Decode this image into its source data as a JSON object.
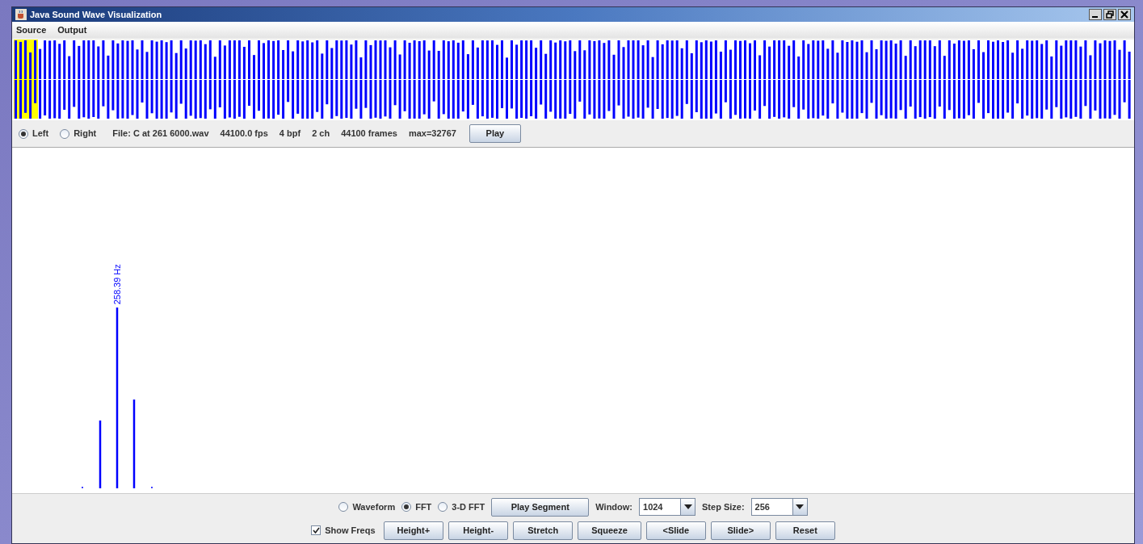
{
  "window": {
    "title": "Java Sound Wave Visualization"
  },
  "menu": [
    "Source",
    "Output"
  ],
  "channels": [
    {
      "label": "Left",
      "selected": true
    },
    {
      "label": "Right",
      "selected": false
    }
  ],
  "file_info": [
    "File: C at 261 6000.wav",
    "44100.0 fps",
    "4 bpf",
    "2 ch",
    "44100 frames",
    "max=32767"
  ],
  "play_button": "Play",
  "spectrum": {
    "peak_label": "258.39 Hz"
  },
  "view_modes": [
    {
      "label": "Waveform",
      "selected": false
    },
    {
      "label": "FFT",
      "selected": true
    },
    {
      "label": "3-D FFT",
      "selected": false
    }
  ],
  "play_segment": "Play Segment",
  "window_size": {
    "label": "Window:",
    "value": "1024"
  },
  "step_size": {
    "label": "Step Size:",
    "value": "256"
  },
  "show_freqs": {
    "label": "Show Freqs",
    "checked": true
  },
  "buttons": [
    "Height+",
    "Height-",
    "Stretch",
    "Squeeze",
    "<Slide",
    "Slide>",
    "Reset"
  ]
}
